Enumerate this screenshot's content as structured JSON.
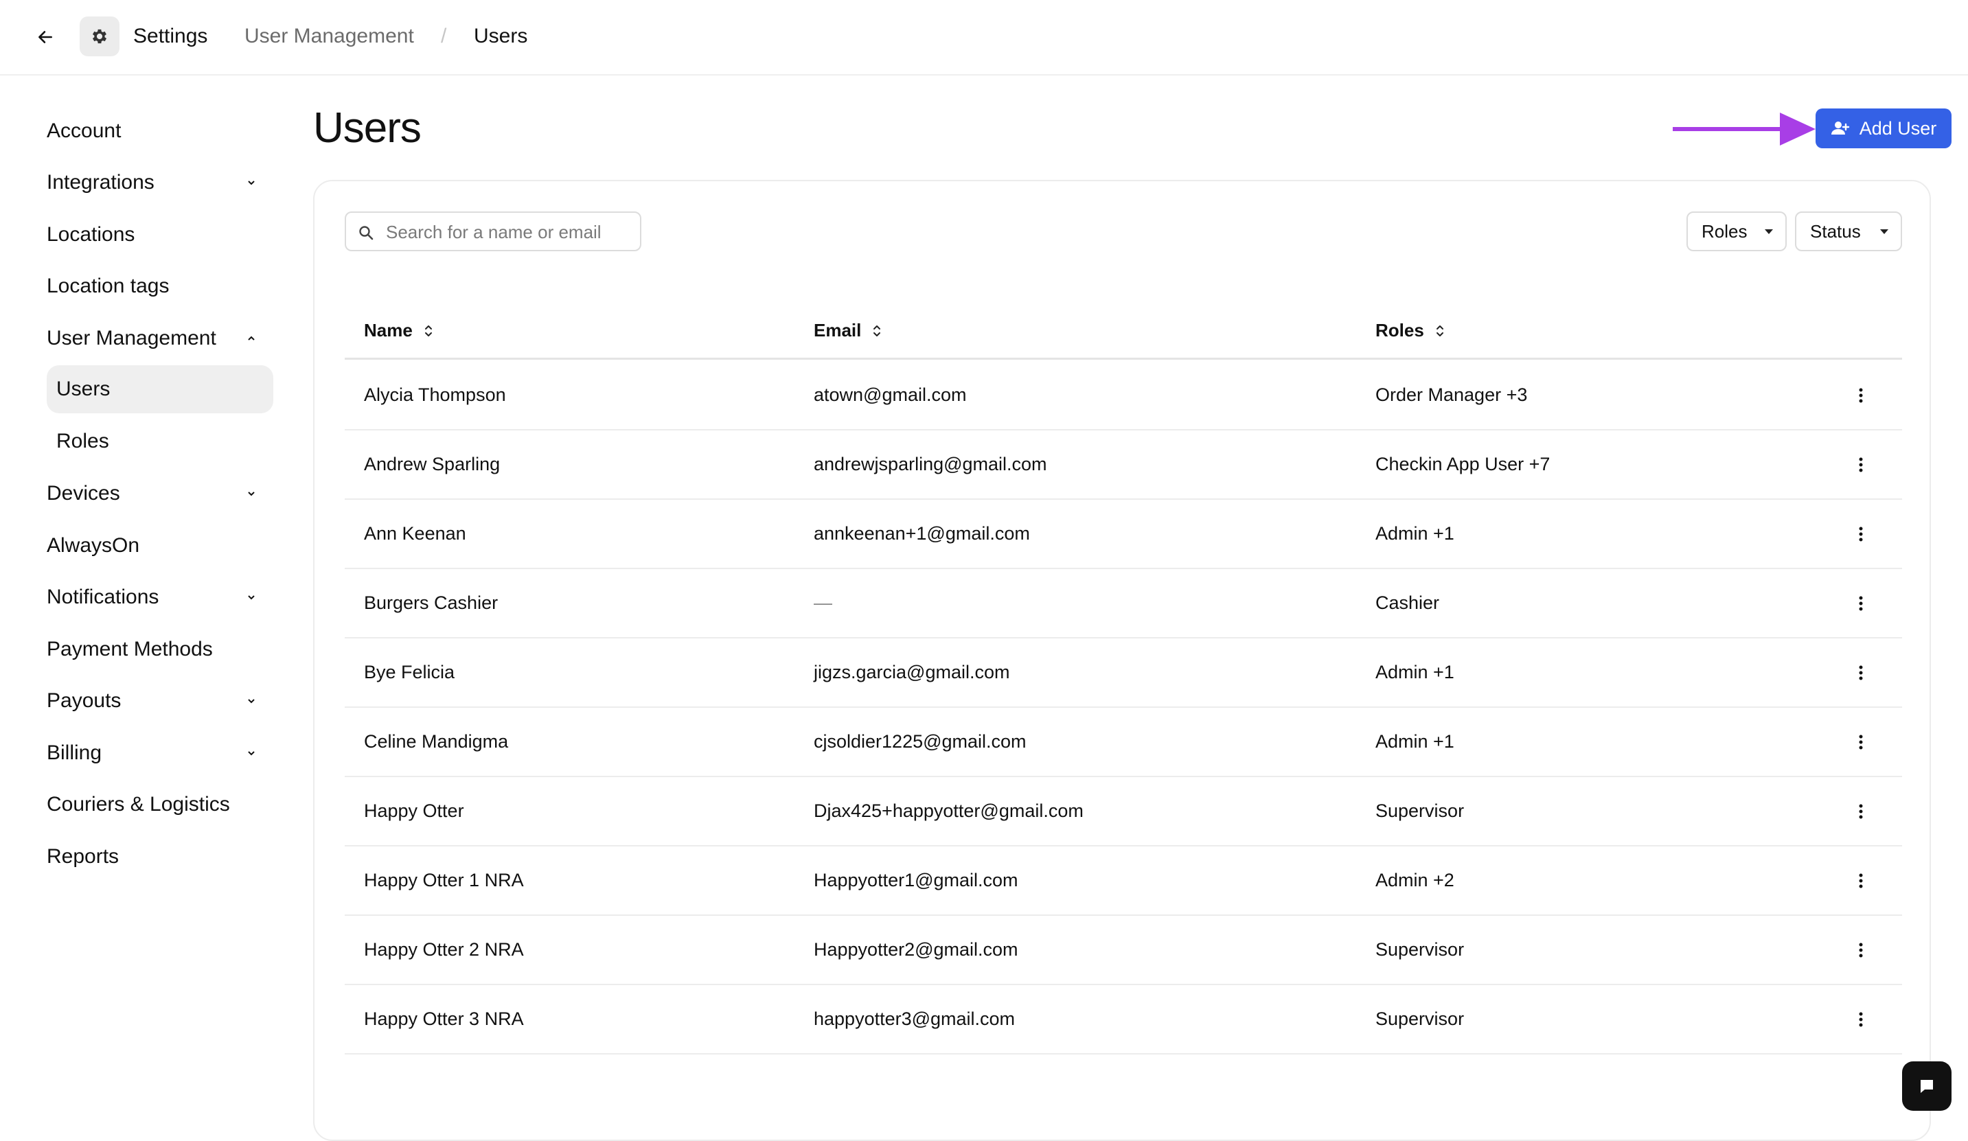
{
  "breadcrumb": {
    "settings": "Settings",
    "user_management": "User Management",
    "separator": "/",
    "users": "Users"
  },
  "sidebar": {
    "items": [
      {
        "label": "Account",
        "chevron": "none"
      },
      {
        "label": "Integrations",
        "chevron": "down"
      },
      {
        "label": "Locations",
        "chevron": "none"
      },
      {
        "label": "Location tags",
        "chevron": "none"
      },
      {
        "label": "User Management",
        "chevron": "up"
      },
      {
        "label": "Users",
        "chevron": "none",
        "sub": true,
        "active": true
      },
      {
        "label": "Roles",
        "chevron": "none",
        "sub": true
      },
      {
        "label": "Devices",
        "chevron": "down"
      },
      {
        "label": "AlwaysOn",
        "chevron": "none"
      },
      {
        "label": "Notifications",
        "chevron": "down"
      },
      {
        "label": "Payment Methods",
        "chevron": "none"
      },
      {
        "label": "Payouts",
        "chevron": "down"
      },
      {
        "label": "Billing",
        "chevron": "down"
      },
      {
        "label": "Couriers & Logistics",
        "chevron": "none"
      },
      {
        "label": "Reports",
        "chevron": "none"
      }
    ]
  },
  "page": {
    "title": "Users",
    "add_user_label": "Add User"
  },
  "search": {
    "placeholder": "Search for a name or email",
    "value": ""
  },
  "filters": {
    "roles": "Roles",
    "status": "Status"
  },
  "table": {
    "headers": {
      "name": "Name",
      "email": "Email",
      "roles": "Roles"
    },
    "rows": [
      {
        "name": "Alycia Thompson",
        "email": "atown@gmail.com",
        "roles": "Order Manager +3"
      },
      {
        "name": "Andrew Sparling",
        "email": "andrewjsparling@gmail.com",
        "roles": "Checkin App User +7"
      },
      {
        "name": "Ann Keenan",
        "email": "annkeenan+1@gmail.com",
        "roles": "Admin +1"
      },
      {
        "name": "Burgers Cashier",
        "email": "—",
        "roles": "Cashier"
      },
      {
        "name": "Bye Felicia",
        "email": "jigzs.garcia@gmail.com",
        "roles": "Admin +1"
      },
      {
        "name": "Celine Mandigma",
        "email": "cjsoldier1225@gmail.com",
        "roles": "Admin +1"
      },
      {
        "name": "Happy Otter",
        "email": "Djax425+happyotter@gmail.com",
        "roles": "Supervisor"
      },
      {
        "name": "Happy Otter 1 NRA",
        "email": "Happyotter1@gmail.com",
        "roles": "Admin +2"
      },
      {
        "name": "Happy Otter 2 NRA",
        "email": "Happyotter2@gmail.com",
        "roles": "Supervisor"
      },
      {
        "name": "Happy Otter 3 NRA",
        "email": "happyotter3@gmail.com",
        "roles": "Supervisor"
      }
    ]
  },
  "colors": {
    "accent": "#3461e6",
    "annotation_arrow": "#a83ee6",
    "chat_button": "#111111"
  },
  "icons": {
    "back": "arrow-left-icon",
    "settings": "gear-icon",
    "add_user": "user-plus-icon",
    "search": "search-icon",
    "sort": "sort-icon",
    "row_menu": "more-vertical-icon",
    "chat": "chat-icon"
  }
}
